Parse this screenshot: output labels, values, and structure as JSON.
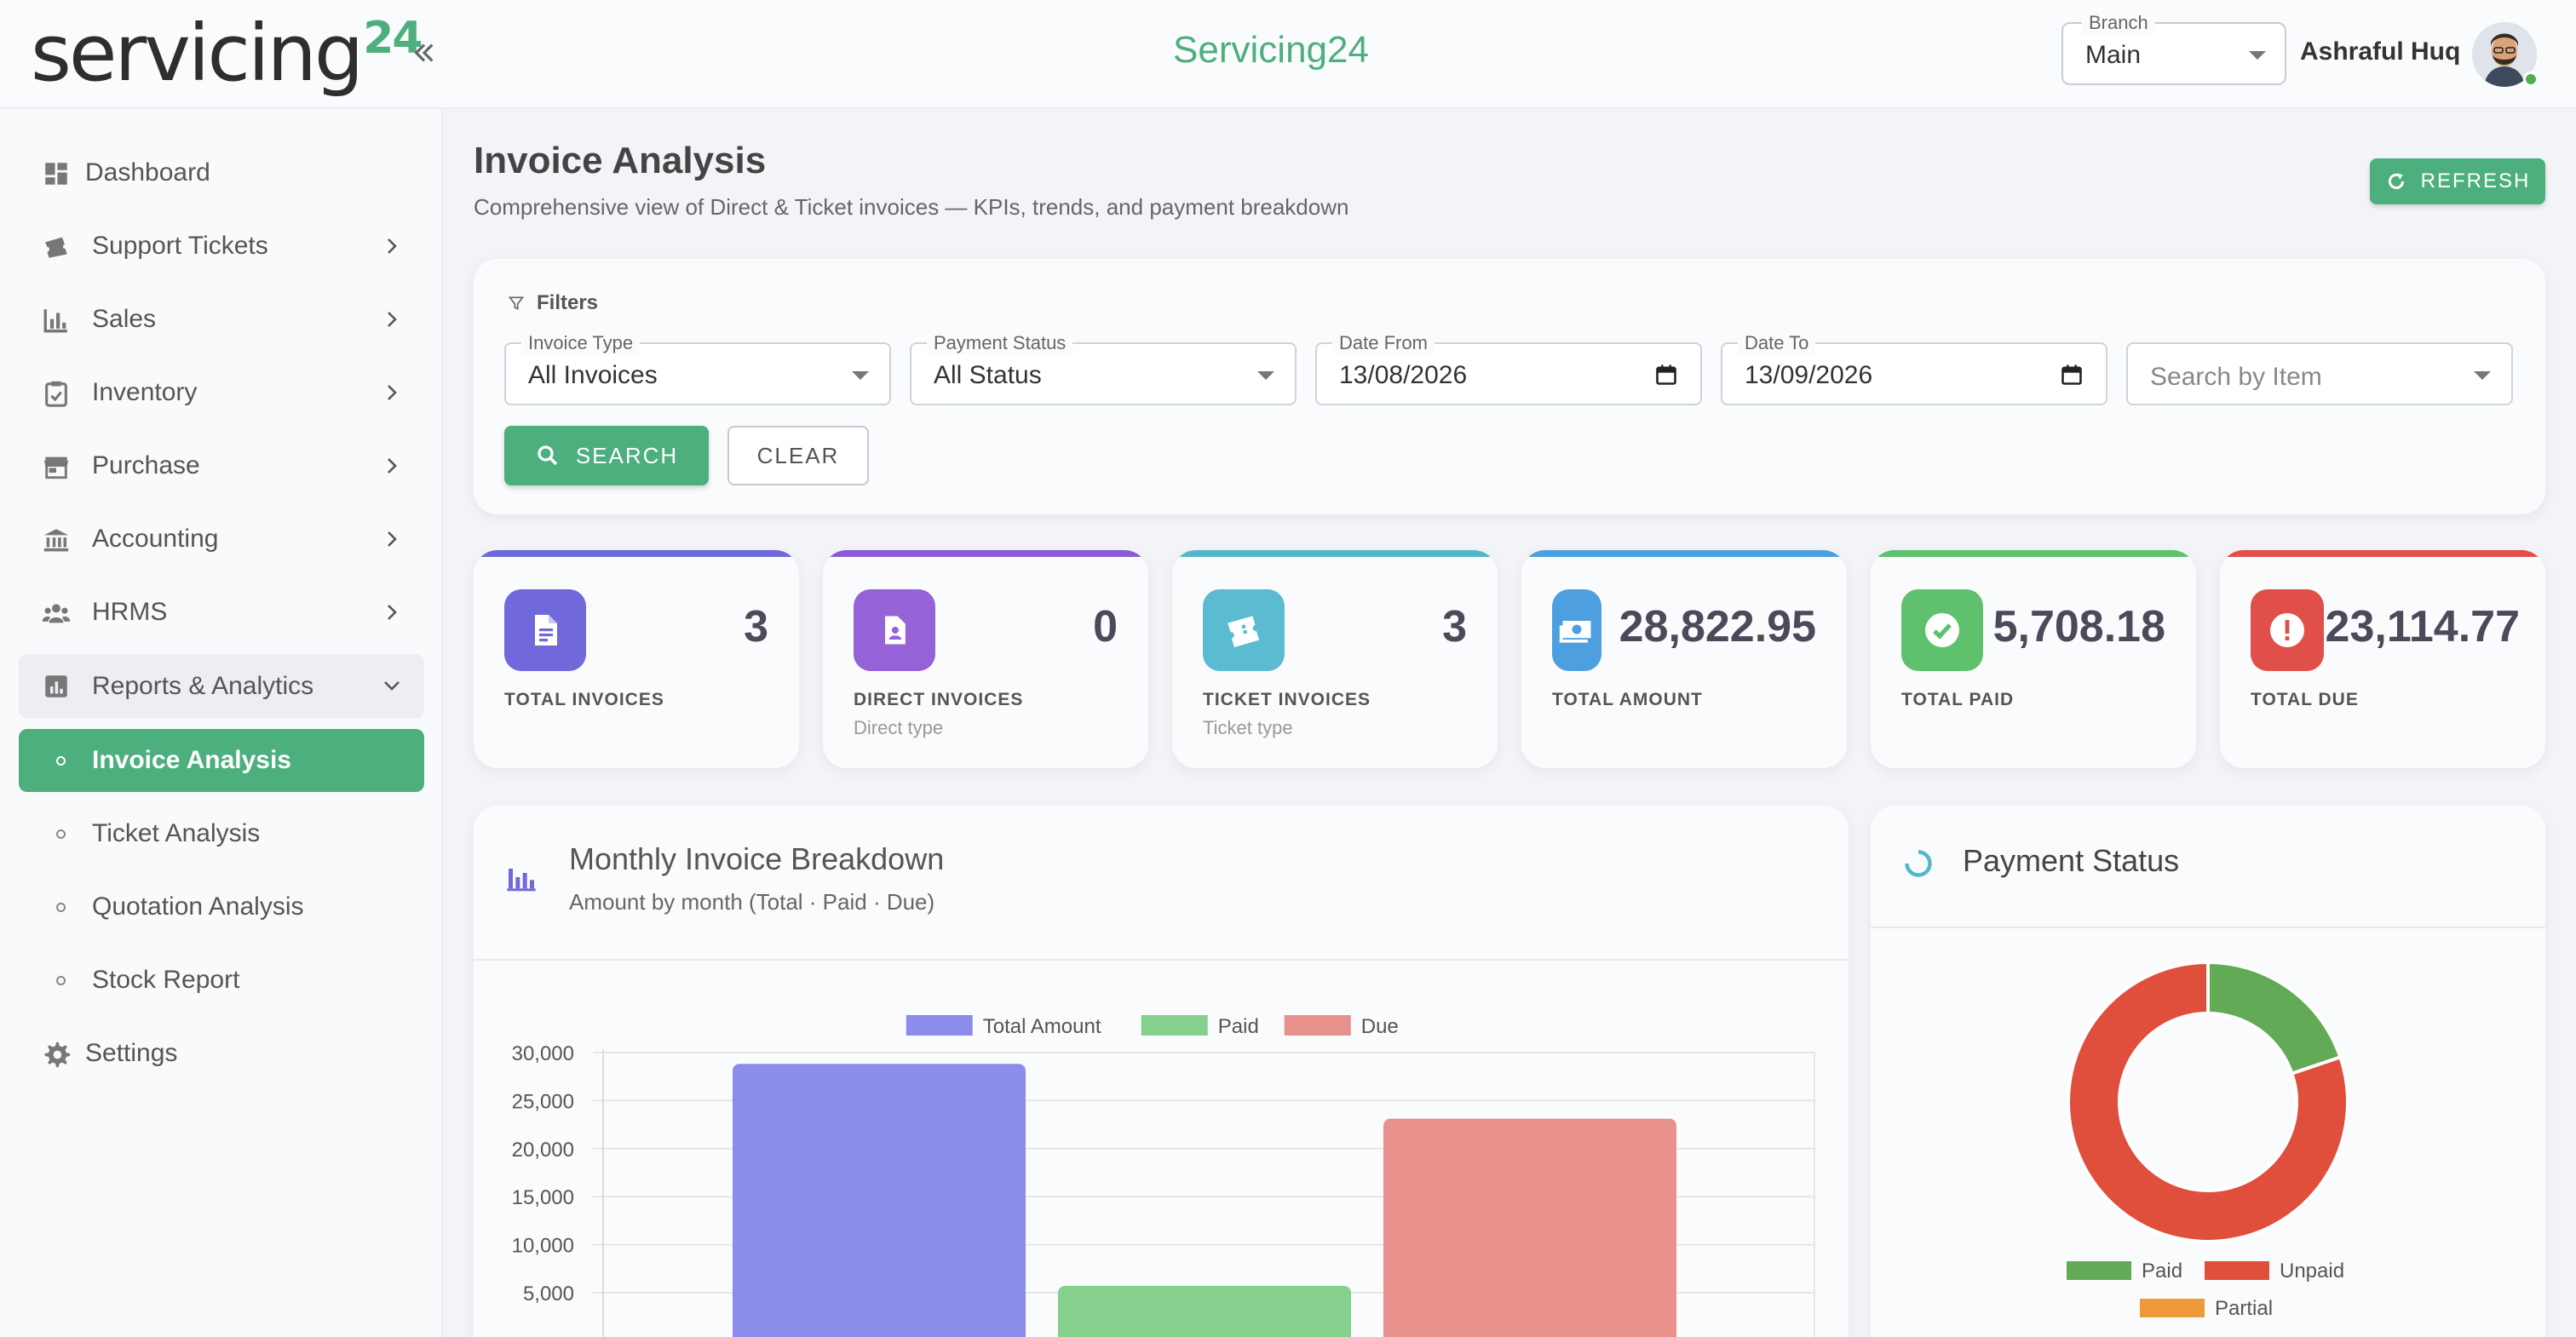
{
  "header": {
    "logo_text": "servicing",
    "logo_number": "24",
    "app_title": "Servicing24",
    "branch_label": "Branch",
    "branch_value": "Main",
    "user_name": "Ashraful Huq"
  },
  "sidebar": {
    "items": [
      {
        "label": "Dashboard",
        "icon": "dashboard-icon"
      },
      {
        "label": "Support Tickets",
        "icon": "ticket-icon"
      },
      {
        "label": "Sales",
        "icon": "bar-chart-icon"
      },
      {
        "label": "Inventory",
        "icon": "clipboard-icon"
      },
      {
        "label": "Purchase",
        "icon": "store-icon"
      },
      {
        "label": "Accounting",
        "icon": "bank-icon"
      },
      {
        "label": "HRMS",
        "icon": "people-icon"
      },
      {
        "label": "Reports & Analytics",
        "icon": "report-icon"
      },
      {
        "label": "Invoice Analysis"
      },
      {
        "label": "Ticket Analysis"
      },
      {
        "label": "Quotation Analysis"
      },
      {
        "label": "Stock Report"
      },
      {
        "label": "Settings",
        "icon": "gear-icon"
      }
    ]
  },
  "page": {
    "title": "Invoice Analysis",
    "subtitle": "Comprehensive view of Direct & Ticket invoices — KPIs, trends, and payment breakdown",
    "refresh_label": "REFRESH"
  },
  "filters": {
    "title": "Filters",
    "invoice_type_label": "Invoice Type",
    "invoice_type_value": "All Invoices",
    "payment_status_label": "Payment Status",
    "payment_status_value": "All Status",
    "date_from_label": "Date From",
    "date_from_value": "13/08/2026",
    "date_to_label": "Date To",
    "date_to_value": "13/09/2026",
    "search_item_placeholder": "Search by Item",
    "search_label": "SEARCH",
    "clear_label": "CLEAR"
  },
  "kpis": [
    {
      "value": "3",
      "label": "TOTAL INVOICES",
      "sub": "",
      "color": "#6f6ad8",
      "icon": "document-icon"
    },
    {
      "value": "0",
      "label": "DIRECT INVOICES",
      "sub": "Direct type",
      "color": "#8a5ad6",
      "icon": "contact-file-icon"
    },
    {
      "value": "3",
      "label": "TICKET INVOICES",
      "sub": "Ticket type",
      "color": "#55b8c9",
      "icon": "ticket-icon"
    },
    {
      "value": "28,822.95",
      "label": "TOTAL AMOUNT",
      "sub": "",
      "color": "#4e9fe0",
      "icon": "cash-icon"
    },
    {
      "value": "5,708.18",
      "label": "TOTAL PAID",
      "sub": "",
      "color": "#5fc06e",
      "icon": "check-circle-icon"
    },
    {
      "value": "23,114.77",
      "label": "TOTAL DUE",
      "sub": "",
      "color": "#e04f4a",
      "icon": "alert-circle-icon"
    }
  ],
  "chart_card": {
    "title": "Monthly Invoice Breakdown",
    "subtitle": "Amount by month (Total · Paid · Due)"
  },
  "pie_card": {
    "title": "Payment Status"
  },
  "chart_data": [
    {
      "type": "bar",
      "title": "",
      "categories": [
        ""
      ],
      "series": [
        {
          "name": "Total Amount",
          "values": [
            28822.95
          ],
          "color": "#8c8cea"
        },
        {
          "name": "Paid",
          "values": [
            5708.18
          ],
          "color": "#86d08e"
        },
        {
          "name": "Due",
          "values": [
            23114.77
          ],
          "color": "#e8918c"
        }
      ],
      "ylim": [
        0,
        30000
      ],
      "yticks": [
        "30,000",
        "25,000",
        "20,000",
        "15,000",
        "10,000",
        "5,000"
      ],
      "ytick_values": [
        30000,
        25000,
        20000,
        15000,
        10000,
        5000
      ],
      "legend_placement": "top-center",
      "grid": true
    },
    {
      "type": "pie",
      "variant": "doughnut",
      "series": [
        {
          "name": "Paid",
          "value": 5708.18,
          "color": "#63aa57"
        },
        {
          "name": "Unpaid",
          "value": 23114.77,
          "color": "#e04e3c"
        },
        {
          "name": "Partial",
          "value": 0,
          "color": "#ee9a3a"
        }
      ],
      "legend_placement": "bottom"
    }
  ]
}
